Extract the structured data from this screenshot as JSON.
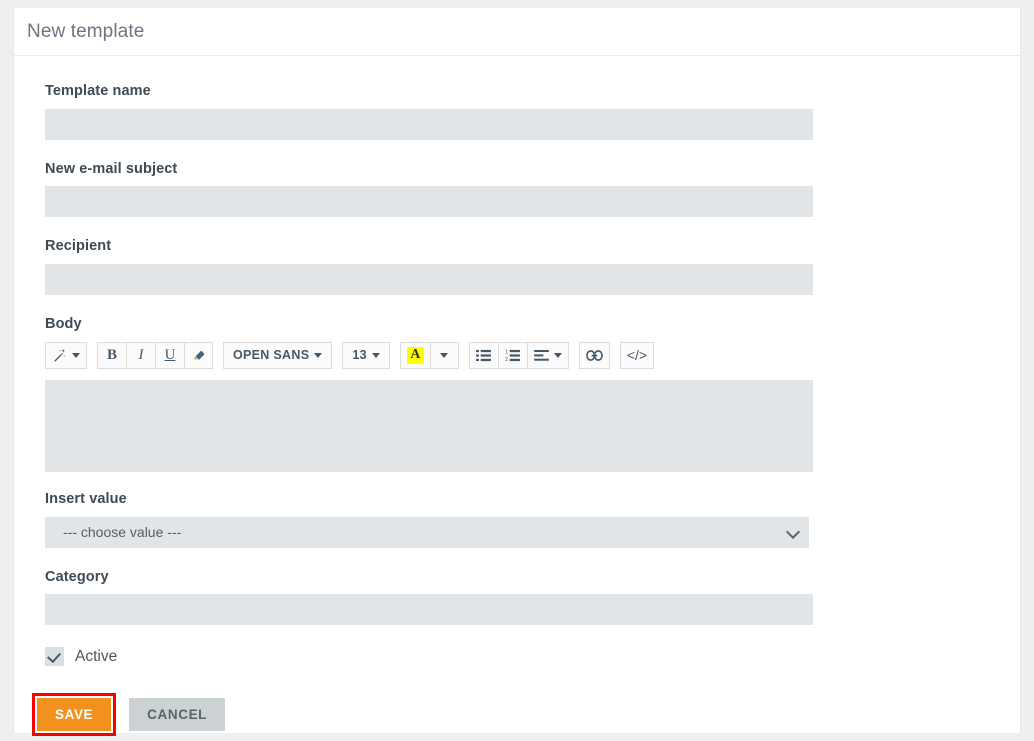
{
  "header": {
    "title": "New template"
  },
  "form": {
    "template_name": {
      "label": "Template name",
      "value": "",
      "placeholder": ""
    },
    "email_subject": {
      "label": "New e-mail subject",
      "value": "",
      "placeholder": ""
    },
    "recipient": {
      "label": "Recipient",
      "value": "",
      "placeholder": ""
    },
    "body": {
      "label": "Body",
      "content": ""
    },
    "insert_value": {
      "label": "Insert value",
      "selected": "--- choose value ---",
      "options": [
        "--- choose value ---"
      ]
    },
    "category": {
      "label": "Category",
      "value": "",
      "placeholder": ""
    },
    "active": {
      "label": "Active",
      "checked": true
    }
  },
  "toolbar": {
    "magic_label": "",
    "bold_label": "B",
    "italic_label": "I",
    "underline_label": "U",
    "eraser_label": "",
    "font_family": "OPEN SANS",
    "font_size": "13",
    "highlight_letter": "A",
    "highlight_color": "#ffff00",
    "bullet_list_label": "",
    "numbered_list_label": "",
    "align_label": "",
    "link_label": "",
    "code_label": "</>"
  },
  "actions": {
    "save_label": "SAVE",
    "cancel_label": "CANCEL"
  },
  "colors": {
    "save_button": "#f2911e",
    "cancel_button": "#ccd1d3",
    "highlight_annotation": "#fc0000",
    "input_background": "#e1e5e7",
    "page_background": "#efefef"
  }
}
